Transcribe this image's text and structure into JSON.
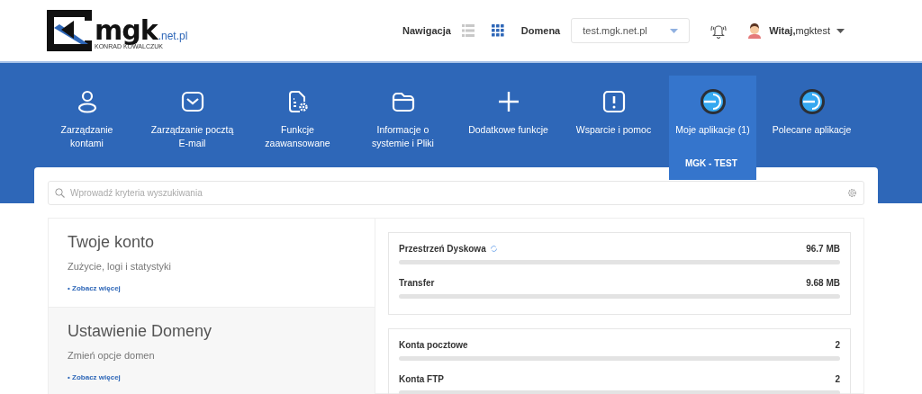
{
  "header": {
    "logo": {
      "name": "mgk",
      "suffix": ".net.pl",
      "tagline": "KONRAD KOWALCZUK"
    },
    "navigation_label": "Nawigacja",
    "views": [
      {
        "selected": false
      },
      {
        "selected": true
      }
    ],
    "domain_label": "Domena",
    "domain_value": "test.mgk.net.pl",
    "greeting": "Witaj,",
    "username": "mgktest"
  },
  "nav_items": [
    {
      "label": "Zarządzanie kontami",
      "selected": false
    },
    {
      "label": "Zarządzanie pocztą E-mail",
      "selected": false
    },
    {
      "label": "Funkcje zaawansowane",
      "selected": false
    },
    {
      "label": "Informacje o systemie i Pliki",
      "selected": false
    },
    {
      "label": "Dodatkowe funkcje",
      "selected": false
    },
    {
      "label": "Wsparcie i pomoc",
      "selected": false
    },
    {
      "label": "Moje aplikacje (1)",
      "selected": true,
      "submenu": [
        "MGK - TEST"
      ]
    },
    {
      "label": "Polecane aplikacje",
      "selected": false
    }
  ],
  "search": {
    "placeholder": "Wprowadź kryteria wyszukiwania"
  },
  "sections": [
    {
      "title": "Twoje konto",
      "subtitle": "Zużycie, logi i statystyki",
      "link": "• Zobacz więcej",
      "highlighted": false
    },
    {
      "title": "Ustawienie Domeny",
      "subtitle": "Zmień opcje domen",
      "link": "• Zobacz więcej",
      "highlighted": true
    }
  ],
  "stat_groups": [
    [
      {
        "label": "Przestrzeń Dyskowa",
        "value": "96.7 MB",
        "loading": true
      },
      {
        "label": "Transfer",
        "value": "9.68 MB"
      }
    ],
    [
      {
        "label": "Konta pocztowe",
        "value": "2"
      },
      {
        "label": "Konta FTP",
        "value": "2"
      }
    ]
  ]
}
